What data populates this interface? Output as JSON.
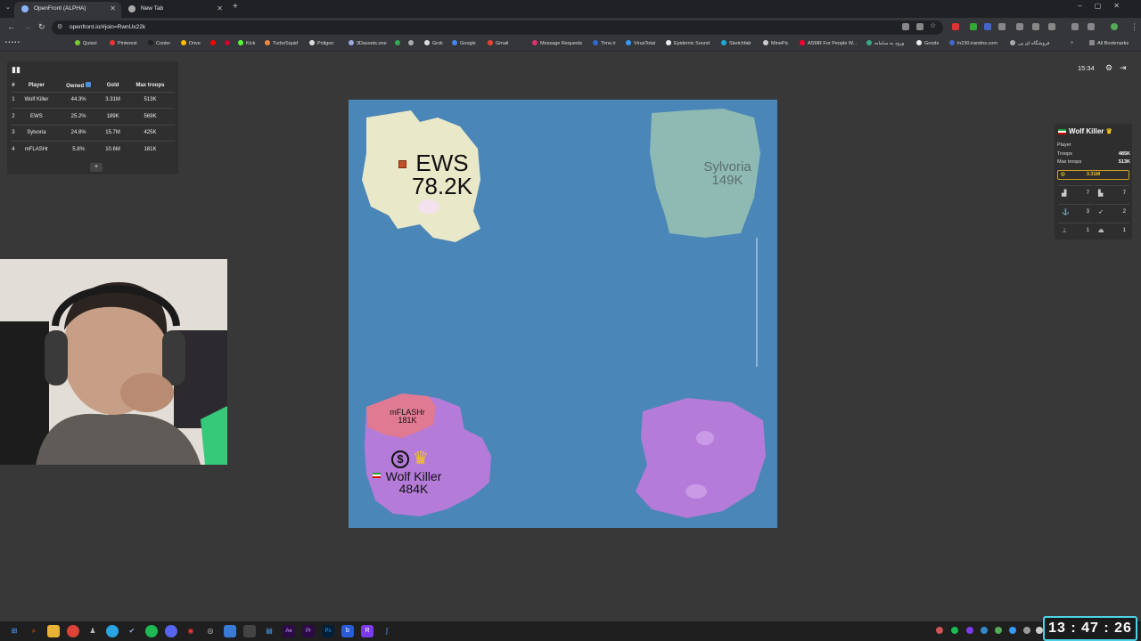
{
  "browser": {
    "tabs": [
      {
        "title": "OpenFront (ALPHA)",
        "active": true
      },
      {
        "title": "New Tab",
        "active": false
      }
    ],
    "url": "openfront.io/#join=RwnUx22k",
    "bookmarks": [
      "Quixel",
      "Pinterest",
      "Cooler",
      "Drive",
      "Kick",
      "TurboSquid",
      "Poligon",
      "3Dassets.one",
      "Grok",
      "Google",
      "Gmail",
      "Message Requests",
      "Time.ir",
      "VirusTotal",
      "Epidemic Sound",
      "Sketchfab",
      "MinePic",
      "ASMR For People W...",
      "ورود به سامانه",
      "Goods",
      "ln230.irandns.com",
      "فروشگاه ای پی",
      "All Bookmarks"
    ]
  },
  "leaderboard": {
    "headers": [
      "#",
      "Player",
      "Owned",
      "Gold",
      "Max troops"
    ],
    "rows": [
      {
        "rank": "1",
        "player": "Wolf Killer",
        "owned": "44.3%",
        "gold": "3.31M",
        "max_troops": "513K"
      },
      {
        "rank": "2",
        "player": "EWS",
        "owned": "25.2%",
        "gold": "189K",
        "max_troops": "569K"
      },
      {
        "rank": "3",
        "player": "Sylvoria",
        "owned": "24.8%",
        "gold": "15.7M",
        "max_troops": "425K"
      },
      {
        "rank": "4",
        "player": "mFLASHr",
        "owned": "5.8%",
        "gold": "10.6M",
        "max_troops": "181K"
      }
    ],
    "more_label": "+"
  },
  "game": {
    "timer": "15:34",
    "map_labels": {
      "ews": {
        "name": "EWS",
        "troops": "78.2K"
      },
      "sylvoria": {
        "name": "Sylvoria",
        "troops": "149K"
      },
      "mflashr": {
        "name": "mFLASHr",
        "troops": "181K"
      },
      "wolf": {
        "name": "Wolf Killer",
        "troops": "484K"
      }
    }
  },
  "player_panel": {
    "name": "Wolf Killer",
    "type": "Player",
    "troops_label": "Troops",
    "troops": "485K",
    "max_troops_label": "Max troops",
    "max_troops": "513K",
    "gold": "3.31M",
    "units": [
      {
        "icon": "city-icon",
        "glyph": "▟",
        "count": "7"
      },
      {
        "icon": "factory-icon",
        "glyph": "▙",
        "count": "7"
      },
      {
        "icon": "port-icon",
        "glyph": "⚓",
        "count": "3"
      },
      {
        "icon": "missile-silo-icon",
        "glyph": "➶",
        "count": "2"
      },
      {
        "icon": "sam-launcher-icon",
        "glyph": "⊥",
        "count": "1"
      },
      {
        "icon": "warship-icon",
        "glyph": "⏏",
        "count": "1"
      }
    ]
  },
  "taskbar": {
    "clock": "13 : 47 : 26"
  },
  "colors": {
    "ocean": "#4a86b8",
    "ews": "#e9e8c8",
    "sylvoria": "#8fb9b3",
    "mflashr": "#e07a93",
    "wolf": "#b57bd9",
    "clock_border": "#4fd1e8"
  }
}
